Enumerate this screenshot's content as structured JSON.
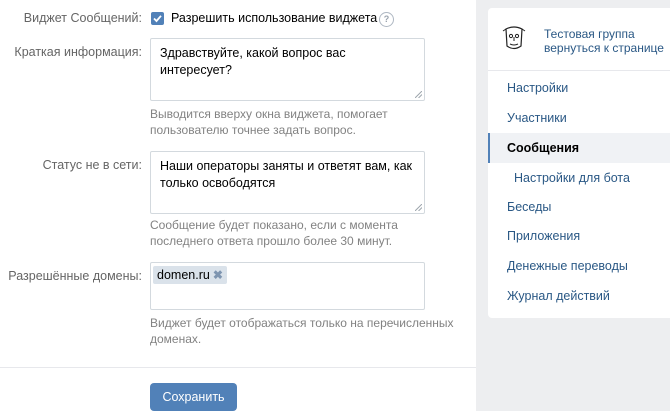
{
  "form": {
    "widget_label": "Виджет Сообщений:",
    "widget_checkbox_label": "Разрешить использование виджета",
    "widget_checked": true,
    "help_icon": "?",
    "intro_label": "Краткая информация:",
    "intro_value": "Здравствуйте, какой вопрос вас интересует?",
    "intro_hint": "Выводится вверху окна виджета, помогает пользователю точнее задать вопрос.",
    "offline_label": "Статус не в сети:",
    "offline_value": "Наши операторы заняты и ответят вам, как только освободятся",
    "offline_hint": "Сообщение будет показано, если с момента последнего ответа прошло более 30 минут.",
    "domains_label": "Разрешённые домены:",
    "domains": [
      "domen.ru"
    ],
    "domain_remove_icon": "✖",
    "domains_hint": "Виджет будет отображаться только на перечисленных доменах.",
    "save_label": "Сохранить"
  },
  "sidebar": {
    "group_name": "Тестовая группа",
    "group_back": "вернуться к странице",
    "items": [
      {
        "label": "Настройки"
      },
      {
        "label": "Участники"
      },
      {
        "label": "Сообщения",
        "active": true
      },
      {
        "label": "Настройки для бота",
        "sub": true
      },
      {
        "label": "Беседы"
      },
      {
        "label": "Приложения"
      },
      {
        "label": "Денежные переводы"
      },
      {
        "label": "Журнал действий"
      }
    ]
  },
  "colors": {
    "accent": "#5181b8",
    "link": "#2a5885",
    "background": "#edeef0"
  }
}
